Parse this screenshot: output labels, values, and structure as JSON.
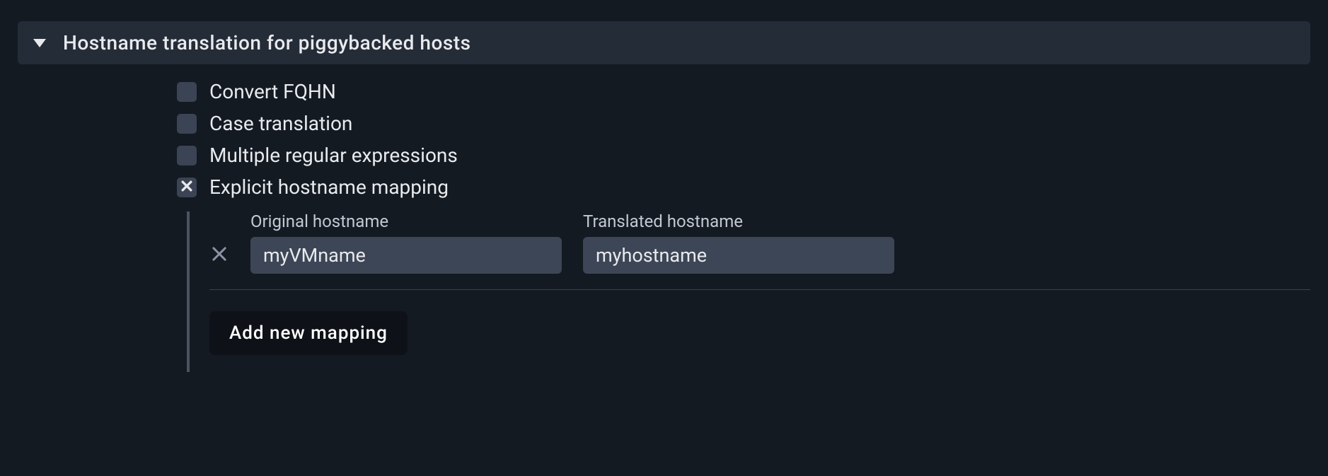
{
  "section": {
    "title": "Hostname translation for piggybacked hosts"
  },
  "options": {
    "convert_fqhn": {
      "label": "Convert FQHN",
      "checked": false
    },
    "case_translation": {
      "label": "Case translation",
      "checked": false
    },
    "multiple_regex": {
      "label": "Multiple regular expressions",
      "checked": false
    },
    "explicit_mapping": {
      "label": "Explicit hostname mapping",
      "checked": true
    }
  },
  "mapping": {
    "original_label": "Original hostname",
    "translated_label": "Translated hostname",
    "rows": [
      {
        "original": "myVMname",
        "translated": "myhostname"
      }
    ],
    "add_button": "Add new mapping"
  }
}
